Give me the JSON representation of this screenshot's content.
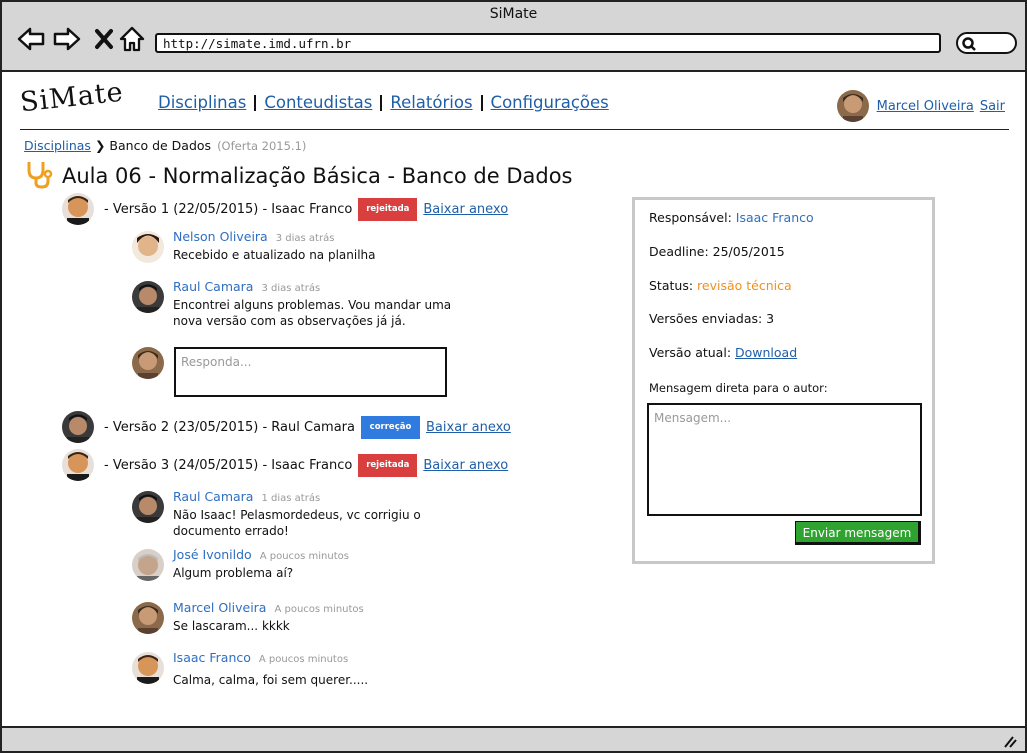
{
  "window": {
    "title": "SiMate"
  },
  "browser": {
    "url": "http://simate.imd.ufrn.br",
    "icons": [
      "back-icon",
      "forward-icon",
      "close-icon",
      "home-icon",
      "search-icon"
    ]
  },
  "header": {
    "logo": "SiMate",
    "nav": [
      {
        "label": "Disciplinas"
      },
      {
        "label": "Conteudistas"
      },
      {
        "label": "Relatórios"
      },
      {
        "label": "Configurações"
      }
    ],
    "user_name": "Marcel Oliveira",
    "logout": "Sair"
  },
  "breadcrumb": {
    "root": "Disciplinas",
    "current": "Banco de Dados",
    "offer": "(Oferta 2015.1)"
  },
  "page": {
    "title": "Aula 06 - Normalização Básica - Banco de Dados",
    "title_icon": "stethoscope-icon"
  },
  "versions": [
    {
      "label": "- Versão 1 (22/05/2015) - Isaac Franco",
      "status": "rejeitada",
      "status_color": "#d93f3f",
      "download": "Baixar anexo",
      "comments": [
        {
          "name": "Nelson Oliveira",
          "time": "3 dias atrás",
          "text": "Recebido e atualizado na planilha"
        },
        {
          "name": "Raul Camara",
          "time": "3 dias atrás",
          "text": "Encontrei alguns problemas. Vou mandar uma nova versão com as observações já já."
        }
      ],
      "reply_placeholder": "Responda..."
    },
    {
      "label": "- Versão 2 (23/05/2015) - Raul Camara",
      "status": "correção",
      "status_color": "#2f7be0",
      "download": "Baixar anexo"
    },
    {
      "label": "- Versão 3 (24/05/2015) - Isaac Franco",
      "status": "rejeitada",
      "status_color": "#d93f3f",
      "download": "Baixar anexo",
      "comments": [
        {
          "name": "Raul Camara",
          "time": "1 dias atrás",
          "text": "Não Isaac! Pelasmordedeus, vc corrigiu o documento errado!"
        },
        {
          "name": "José Ivonildo",
          "time": "A poucos minutos",
          "text": "Algum problema aí?"
        },
        {
          "name": "Marcel Oliveira",
          "time": "A poucos minutos",
          "text": "Se lascaram... kkkk"
        },
        {
          "name": "Isaac Franco",
          "time": "A poucos minutos",
          "text": "Calma, calma, foi sem querer....."
        }
      ]
    }
  ],
  "info": {
    "responsavel_label": "Responsável:",
    "responsavel": "Isaac Franco",
    "deadline": "Deadline: 25/05/2015",
    "status_label": "Status:",
    "status": "revisão técnica",
    "status_color": "#f0901e",
    "versoes": "Versões enviadas: 3",
    "versao_atual_label": "Versão atual:",
    "versao_atual_link": "Download",
    "mensagem_label": "Mensagem direta para o autor:",
    "mensagem_placeholder": "Mensagem...",
    "send_button": "Enviar mensagem",
    "send_color": "#2fa32f"
  },
  "colors": {
    "link": "#1f5fa8",
    "name": "#2f6fc0",
    "chrome": "#d6d6d6"
  }
}
